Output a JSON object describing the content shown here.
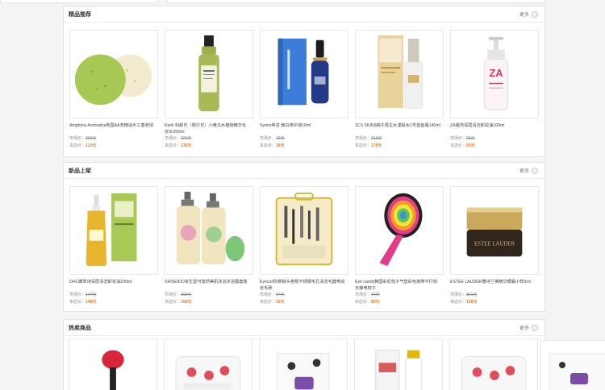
{
  "sections": [
    {
      "title": "精品推荐",
      "more": "更多",
      "products": [
        {
          "name": "Amphora Aromatics英国AA芳精油手工香皂球",
          "market_label": "市场价：",
          "market_price": "339元",
          "store_label": "本店价：",
          "store_price": "113元"
        },
        {
          "name": "Kiehl 科颜氏（契尔氏）小黄瓜水植物精华化妆水250ml",
          "market_label": "市场价：",
          "market_price": "229元",
          "store_label": "本店价：",
          "store_price": "130元"
        },
        {
          "name": "Syrinx希芸 微白修护液10ml",
          "market_label": "市场价：",
          "market_price": "49元",
          "store_label": "本店价：",
          "store_price": "18元"
        },
        {
          "name": "3CS SKIN9蜗牛再生水漾肤水1号蓝金瓶140ml",
          "market_label": "市场价：",
          "market_price": "213元",
          "store_label": "本店价：",
          "store_price": "178元"
        },
        {
          "name": "ZA姬芮深层清洁卸妆油100ml",
          "market_label": "市场价：",
          "market_price": "93元",
          "store_label": "本店价：",
          "store_price": "50元"
        }
      ]
    },
    {
      "title": "新品上架",
      "more": "更多",
      "products": [
        {
          "name": "DHC蝶翠诗深层清洁卸妆油200ml",
          "market_label": "市场价：",
          "market_price": "177元",
          "store_label": "本店价：",
          "store_price": "148元"
        },
        {
          "name": "SHISEIDO资生堂可悠然美肌沐浴沐浴露套装",
          "market_label": "市场价：",
          "market_price": "199元",
          "store_label": "本店价：",
          "store_price": "158元"
        },
        {
          "name": "Eyecurl防刷掉头卷棍不锈钢毛孔清洁毛器电动去毛刷",
          "market_label": "市场价：",
          "market_price": "57元",
          "store_label": "本店价：",
          "store_price": "35元"
        },
        {
          "name": "Eye candy韩国彩虹梳子气垫彩色按摩不打结无静电梳子",
          "market_label": "市场价：",
          "market_price": "40元",
          "store_label": "本店价：",
          "store_price": "80元"
        },
        {
          "name": "ESTEE LAUDER雅诗兰黛精华眼霜小样5ml",
          "market_label": "市场价：",
          "market_price": "151元",
          "store_label": "本店价：",
          "store_price": "128元"
        }
      ]
    },
    {
      "title": "热卖商品",
      "more": "更多"
    }
  ],
  "colors": {
    "accent": "#f07a12",
    "border": "#e3e3e3",
    "background": "#f4f4f4"
  }
}
